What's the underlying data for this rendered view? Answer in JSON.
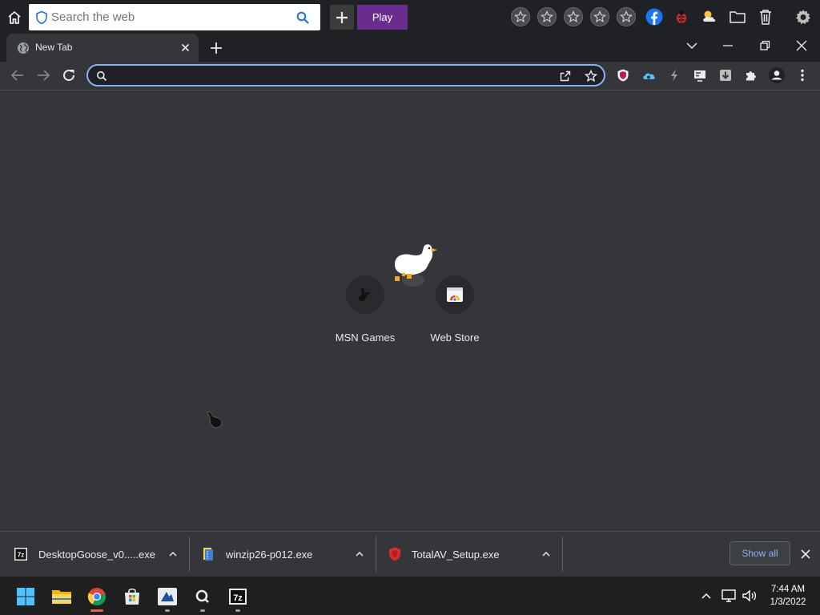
{
  "toolbar": {
    "search_placeholder": "Search the web",
    "play_label": "Play"
  },
  "tab": {
    "title": "New Tab"
  },
  "omnibox": {
    "value": ""
  },
  "shortcuts": [
    {
      "label": "MSN Games",
      "icon": "msn-games-icon"
    },
    {
      "label": "Web Store",
      "icon": "web-store-icon"
    }
  ],
  "downloads": [
    {
      "filename": "DesktopGoose_v0.....exe",
      "icon": "7zip-archive-icon"
    },
    {
      "filename": "winzip26-p012.exe",
      "icon": "winzip-icon"
    },
    {
      "filename": "TotalAV_Setup.exe",
      "icon": "totalav-shield-icon"
    }
  ],
  "shelf": {
    "show_all_label": "Show all"
  },
  "clock": {
    "time": "7:44 AM",
    "date": "1/3/2022"
  },
  "colors": {
    "accent": "#8ab4f8",
    "play_button": "#6a2d8e",
    "page_background": "#35363a",
    "frame": "#202124"
  }
}
